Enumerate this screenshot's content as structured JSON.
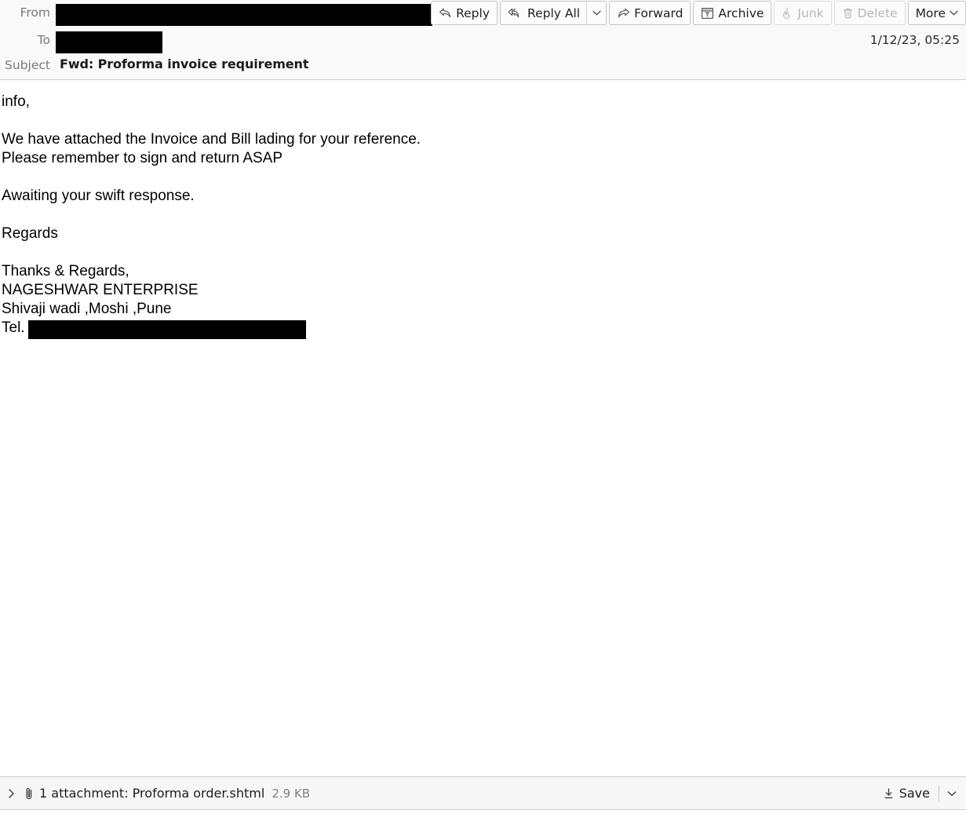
{
  "header": {
    "from_label": "From",
    "from_value_redacted": true,
    "to_label": "To",
    "to_value_redacted": true,
    "subject_label": "Subject",
    "subject_value": "Fwd: Proforma invoice requirement",
    "date": "1/12/23, 05:25"
  },
  "toolbar": {
    "reply": {
      "label": "Reply",
      "icon": "reply-arrow-icon",
      "disabled": false
    },
    "reply_all": {
      "label": "Reply All",
      "icon": "reply-all-arrow-icon",
      "disabled": false,
      "dropdown_icon": "chevron-down-icon"
    },
    "forward": {
      "label": "Forward",
      "icon": "forward-arrow-icon",
      "disabled": false
    },
    "archive": {
      "label": "Archive",
      "icon": "archive-box-icon",
      "disabled": false
    },
    "junk": {
      "label": "Junk",
      "icon": "flame-icon",
      "disabled": true
    },
    "delete": {
      "label": "Delete",
      "icon": "trash-can-icon",
      "disabled": true
    },
    "more": {
      "label": "More",
      "icon": "chevron-down-icon",
      "disabled": false
    }
  },
  "body": {
    "text": "info,\n\nWe have attached the Invoice and Bill lading for your reference.\nPlease remember to sign and return ASAP\n\nAwaiting your swift response.\n\nRegards\n\nThanks & Regards,\nNAGESHWAR ENTERPRISE\nShivaji wadi ,Moshi ,Pune",
    "tel_label": "Tel.",
    "tel_value_redacted": true
  },
  "attachments": {
    "expander_icon": "chevron-right-icon",
    "clip_icon": "paperclip-icon",
    "summary": "1 attachment: Proforma order.shtml",
    "size": "2.9 KB",
    "save_label": "Save",
    "save_icon": "download-icon",
    "save_dropdown_icon": "chevron-down-icon"
  },
  "colors": {
    "header_bg": "#f9f9fa",
    "body_bg": "#ffffff",
    "attachment_bg": "#f7f7f7",
    "label_text": "#7a7a7a",
    "disabled_text": "#b8b8b8",
    "border": "#cfcfcf",
    "redaction": "#000000"
  }
}
